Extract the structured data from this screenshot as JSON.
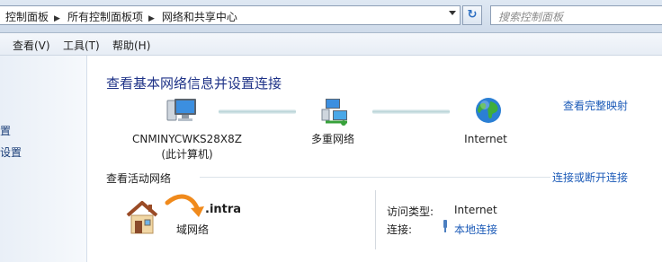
{
  "address_bar": {
    "breadcrumbs": [
      "控制面板",
      "所有控制面板项",
      "网络和共享中心"
    ],
    "search_placeholder": "搜索控制面板"
  },
  "menu": [
    "查看(V)",
    "工具(T)",
    "帮助(H)"
  ],
  "left_pane": {
    "items": [
      "置",
      "设置"
    ]
  },
  "main": {
    "title": "查看基本网络信息并设置连接",
    "view_full_map": "查看完整映射",
    "nodes": [
      {
        "name": "CNMINYCWKS28X8Z",
        "sub": "(此计算机)",
        "icon": "computer-icon"
      },
      {
        "name": "多重网络",
        "icon": "network-icon"
      },
      {
        "name": "Internet",
        "icon": "globe-icon"
      }
    ],
    "active_label": "查看活动网络",
    "connect_link": "连接或断开连接",
    "network": {
      "name": ".intra",
      "type": "域网络",
      "icon": "house-icon"
    },
    "access_type_label": "访问类型:",
    "access_type_value": "Internet",
    "connections_label": "连接:",
    "connection_value": "本地连接",
    "connection_icon": "ethernet-icon"
  }
}
